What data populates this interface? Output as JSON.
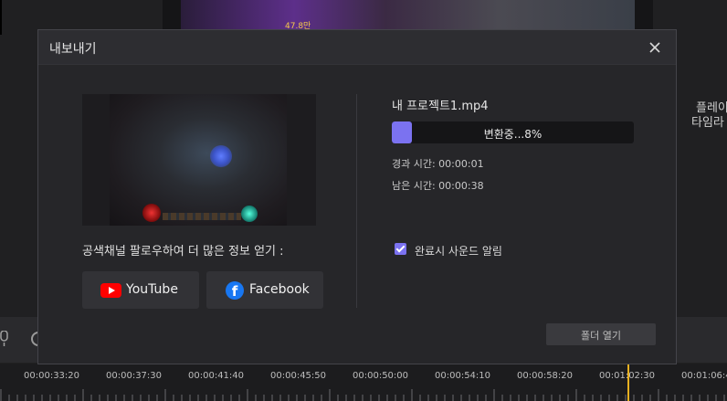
{
  "background": {
    "preview_number": "47.8만",
    "side_text_line1": "플레이",
    "side_text_line2": "타임라",
    "timeline_labels": [
      "00:00:33:20",
      "00:00:37:30",
      "00:00:41:40",
      "00:00:45:50",
      "00:00:50:00",
      "00:00:54:10",
      "00:00:58:20",
      "00:01:02:30",
      "00:01:06:40"
    ],
    "playhead_color": "#e8b020"
  },
  "dialog": {
    "title": "내보내기",
    "follow_text": "공색채널 팔로우하여 더 많은 정보 얻기 :",
    "youtube_label": "YouTube",
    "facebook_label": "Facebook",
    "file_name": "내 프로젝트1.mp4",
    "progress_text": "변환중...8%",
    "progress_fraction": 0.08,
    "elapsed_label": "경과 시간: 00:00:01",
    "remaining_label": "남은 시간: 00:00:38",
    "notify_label": "완료시 사운드 알림",
    "notify_checked": true,
    "open_folder_label": "폴더 열기",
    "accent_color": "#7b72f0"
  }
}
